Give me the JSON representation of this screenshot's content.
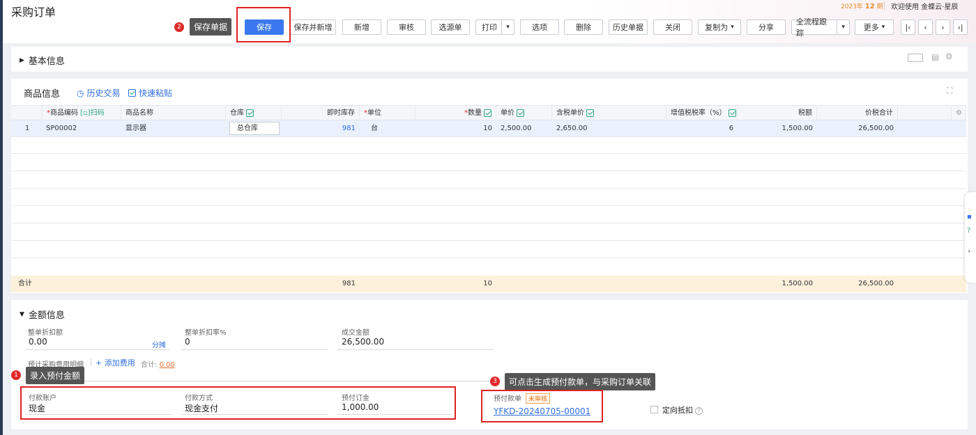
{
  "header": {
    "title": "采购订单",
    "period_year": "2023年",
    "period_num": "12",
    "period_suffix": "期",
    "welcome": "欢迎使用 金蝶云·星辰"
  },
  "toolbar": {
    "buttons": [
      "保存",
      "保存并新增",
      "新增",
      "审核",
      "选源单",
      "打印",
      "选项",
      "删除",
      "历史单据",
      "关闭",
      "复制为",
      "分享",
      "全流程跟踪",
      "更多"
    ]
  },
  "annotations": {
    "tip1": {
      "num": "1",
      "text": "录入预付金额"
    },
    "tip2": {
      "num": "2",
      "text": "保存单据"
    },
    "tip3": {
      "num": "3",
      "text": "可点击生成预付款单，与采购订单关联"
    }
  },
  "basic_section": {
    "title": "基本信息"
  },
  "goods_section": {
    "title": "商品信息",
    "history_link": "历史交易",
    "paste_link": "快速粘贴",
    "scan_label": "扫码",
    "columns": {
      "code": "商品编码",
      "name": "商品名称",
      "warehouse": "仓库",
      "stock": "即时库存",
      "unit": "单位",
      "qty": "数量",
      "price": "单价",
      "tax_price": "含税单价",
      "tax_rate": "增值税税率（%）",
      "tax": "税额",
      "total": "价税合计"
    },
    "rows": [
      {
        "no": "1",
        "code": "SP00002",
        "name": "显示器",
        "warehouse": "总仓库",
        "stock": "981",
        "unit": "台",
        "qty": "10",
        "price": "2,500.00",
        "tax_price": "2,650.00",
        "tax_rate": "6",
        "tax": "1,500.00",
        "total": "26,500.00"
      }
    ],
    "totals": {
      "label": "合计",
      "stock": "981",
      "qty": "10",
      "tax": "1,500.00",
      "total": "26,500.00"
    }
  },
  "amount_section": {
    "title": "金额信息",
    "discount_amount_label": "整单折扣额",
    "discount_amount": "0.00",
    "split_label": "分摊",
    "discount_rate_label": "整单折扣率%",
    "discount_rate": "0",
    "deal_amount_label": "成交金额",
    "deal_amount": "26,500.00",
    "fee_detail_label": "预计采购费用明细",
    "add_fee_label": "+ 添加费用",
    "fee_total_label": "合计:",
    "fee_total": "0.00",
    "pay_account_label": "付款账户",
    "pay_account": "现金",
    "pay_method_label": "付款方式",
    "pay_method": "现金支付",
    "prepay_label": "预付订金",
    "prepay": "1,000.00",
    "prepay_doc_label": "预付款单",
    "prepay_doc_status": "未审核",
    "prepay_doc_no": "YFKD-20240705-00001",
    "directed_offset_label": "定向抵扣"
  },
  "colors": {
    "primary": "#3a78f0",
    "highlight": "#e02020",
    "link": "#2f6fe0",
    "total_bg": "#fdf1dc"
  }
}
